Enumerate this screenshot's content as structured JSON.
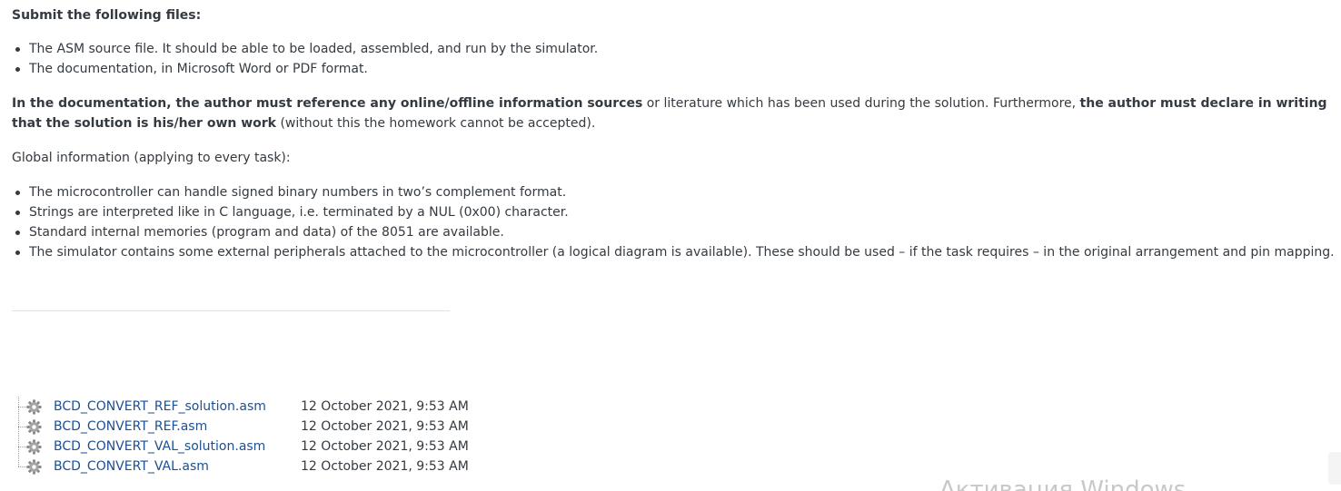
{
  "submit": {
    "heading": "Submit the following files:",
    "items": [
      {
        "text": "The ASM source file. It should be able to be loaded, assembled, and run by the simulator."
      },
      {
        "text": "The documentation, in Microsoft Word or PDF format."
      }
    ]
  },
  "documentation": {
    "bold1": "In the documentation, the author must reference any online/offline information sources",
    "text1": " or literature which has been used during the solution. Furthermore, ",
    "bold2": "the author must declare in writing that the solution is his/her own work",
    "text2": " (without this the homework cannot be accepted)."
  },
  "global": {
    "intro": "Global information (applying to every task):",
    "items": [
      {
        "text": "The microcontroller can handle signed binary numbers in two’s complement format."
      },
      {
        "text": "Strings are interpreted like in C language, i.e. terminated by a NUL (0x00) character."
      },
      {
        "text": "Standard internal memories (program and data) of the 8051 are available."
      },
      {
        "text": "The simulator contains some external peripherals attached to the microcontroller (a logical diagram is available). These should be used – if the task requires – in the original arrangement and pin mapping."
      }
    ]
  },
  "files": [
    {
      "name": "BCD_CONVERT_REF_solution.asm",
      "date": "12 October 2021, 9:53 AM",
      "icon": "gear-icon"
    },
    {
      "name": "BCD_CONVERT_REF.asm",
      "date": "12 October 2021, 9:53 AM",
      "icon": "gear-icon"
    },
    {
      "name": "BCD_CONVERT_VAL_solution.asm",
      "date": "12 October 2021, 9:53 AM",
      "icon": "gear-icon"
    },
    {
      "name": "BCD_CONVERT_VAL.asm",
      "date": "12 October 2021, 9:53 AM",
      "icon": "gear-icon"
    }
  ],
  "watermark": "Активация Windows",
  "colors": {
    "text": "#343a40",
    "link": "#1d4f91",
    "divider": "#dee2e6"
  }
}
